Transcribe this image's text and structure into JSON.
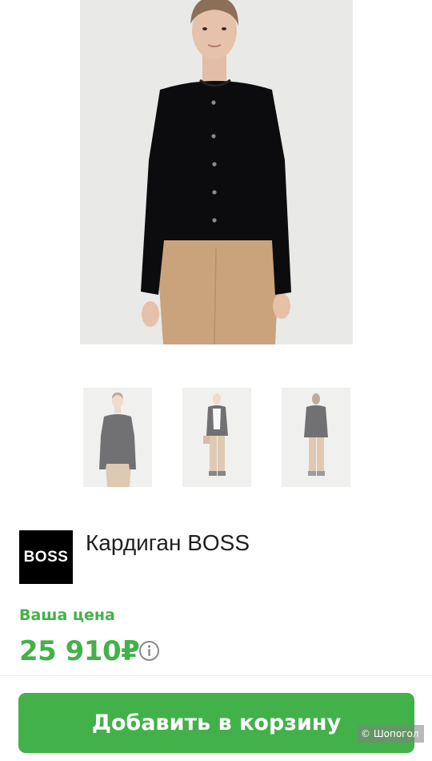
{
  "product": {
    "brand_logo_text": "BOSS",
    "title": "Кардиган BOSS",
    "price_label": "Ваша цена",
    "price": "25 910₽",
    "cart_button_label": "Добавить в корзину"
  },
  "gallery": {
    "main_image": "model-black-cardigan-beige-trousers",
    "thumbnails": [
      "front-view",
      "full-length-front",
      "full-length-back"
    ]
  },
  "icons": {
    "info": "info-icon"
  },
  "watermark": "© Шопогол",
  "colors": {
    "accent": "#43b14a",
    "logo_bg": "#000000",
    "text": "#1f1f1f"
  }
}
